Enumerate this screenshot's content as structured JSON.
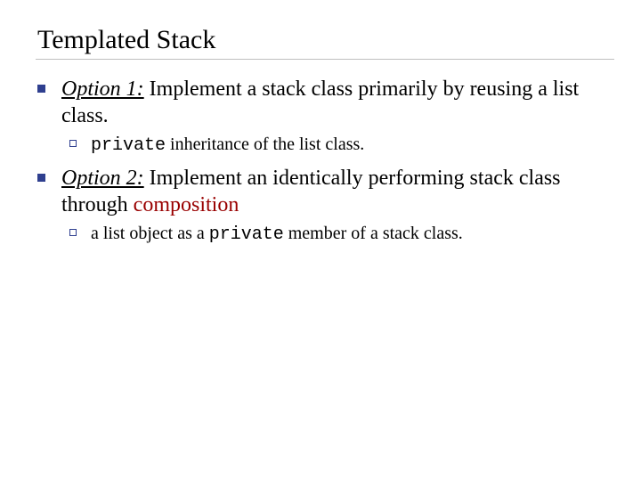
{
  "title": "Templated Stack",
  "option1": {
    "label": "Option 1:",
    "rest": " Implement a stack class primarily by reusing a list class.",
    "sub_code": "private",
    "sub_rest": " inheritance of the list class."
  },
  "option2": {
    "label": "Option 2:",
    "rest_a": " Implement an identically performing stack class through ",
    "rest_red": "composition",
    "sub_a": "a list object as a ",
    "sub_code": "private",
    "sub_b": " member of a stack class."
  }
}
